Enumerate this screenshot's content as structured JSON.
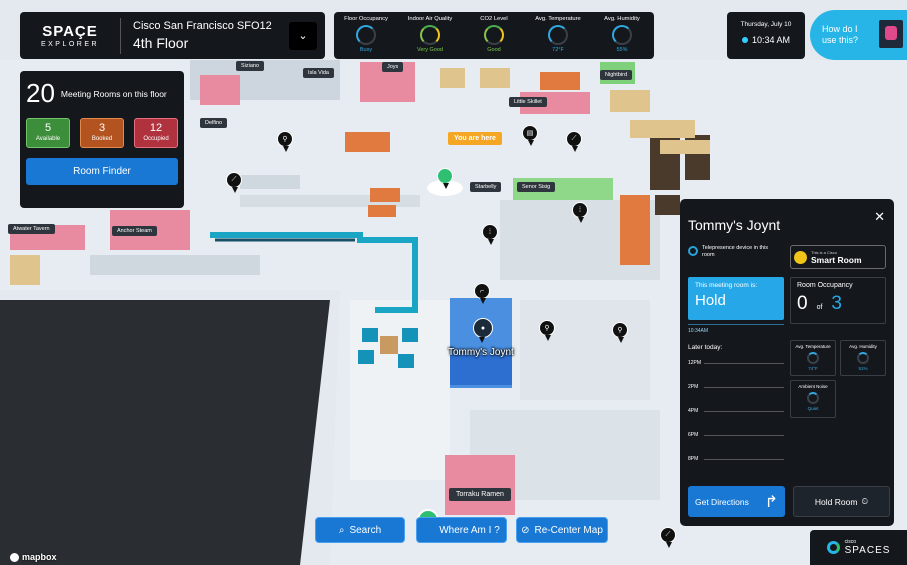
{
  "header": {
    "logo_main": "SPAÇE",
    "logo_sub": "EXPLORER",
    "building": "Cisco San Francisco SFO12",
    "floor": "4th Floor",
    "floor_dropdown_icon": "chevron-down-icon"
  },
  "metrics": [
    {
      "title": "Floor Occupancy",
      "value": "Busy",
      "color": "#32a8e0"
    },
    {
      "title": "Indoor Air Quality",
      "value": "Very Good",
      "color": "#7bc84b"
    },
    {
      "title": "CO2 Level",
      "value": "Good",
      "color": "#7bc84b"
    },
    {
      "title": "Avg. Temperature",
      "value": "72°F",
      "color": "#32a8e0"
    },
    {
      "title": "Avg. Humidity",
      "value": "55%",
      "color": "#32a8e0"
    }
  ],
  "clock": {
    "date": "Thursday, July 10",
    "time": "10:34 AM"
  },
  "help": {
    "label": "How do I use this?"
  },
  "rooms_panel": {
    "count": "20",
    "label": "Meeting Rooms on this floor",
    "available": "5",
    "available_label": "Available",
    "booked": "3",
    "booked_label": "Booked",
    "occupied": "12",
    "occupied_label": "Occupied",
    "finder_button": "Room Finder"
  },
  "map": {
    "labels": [
      "Siziano",
      "Isla Vida",
      "Joys",
      "Nightbird",
      "Little Skillet",
      "Delfino",
      "Starbelly",
      "Senor Sisig",
      "Atwater Tavern",
      "Anchor Steam",
      "Torraku Ramen"
    ],
    "you_are_here": "You are here",
    "selected_room": "Tommy's Joynt",
    "attribution": "mapbox"
  },
  "room_panel": {
    "title": "Tommy's Joynt",
    "close_icon": "close-icon",
    "telepresence": "Telepresence device in this room",
    "smart_small": "This is a Cisco",
    "smart_big": "Smart Room",
    "status_label": "This meeting room is:",
    "status_value": "Hold",
    "status_time": "10:34AM",
    "occupancy_label": "Room Occupancy",
    "occupancy_current": "0",
    "occupancy_of": "of",
    "occupancy_capacity": "3",
    "later_today": "Later today:",
    "schedule_hours": [
      "12PM",
      "2PM",
      "4PM",
      "6PM",
      "8PM"
    ],
    "temp_label": "Avg. Temperature",
    "temp_value": "74°F",
    "humidity_label": "Avg. Humidity",
    "humidity_value": "51%",
    "noise_label": "Ambient Noise",
    "noise_value": "Quiet",
    "directions_button": "Get Directions",
    "hold_button": "Hold Room"
  },
  "bottom": {
    "search": "Search",
    "where_am_i": "Where Am I ?",
    "recenter": "Re-Center Map"
  },
  "brand_footer": {
    "t1": "cisco",
    "t2": "SPACES"
  }
}
